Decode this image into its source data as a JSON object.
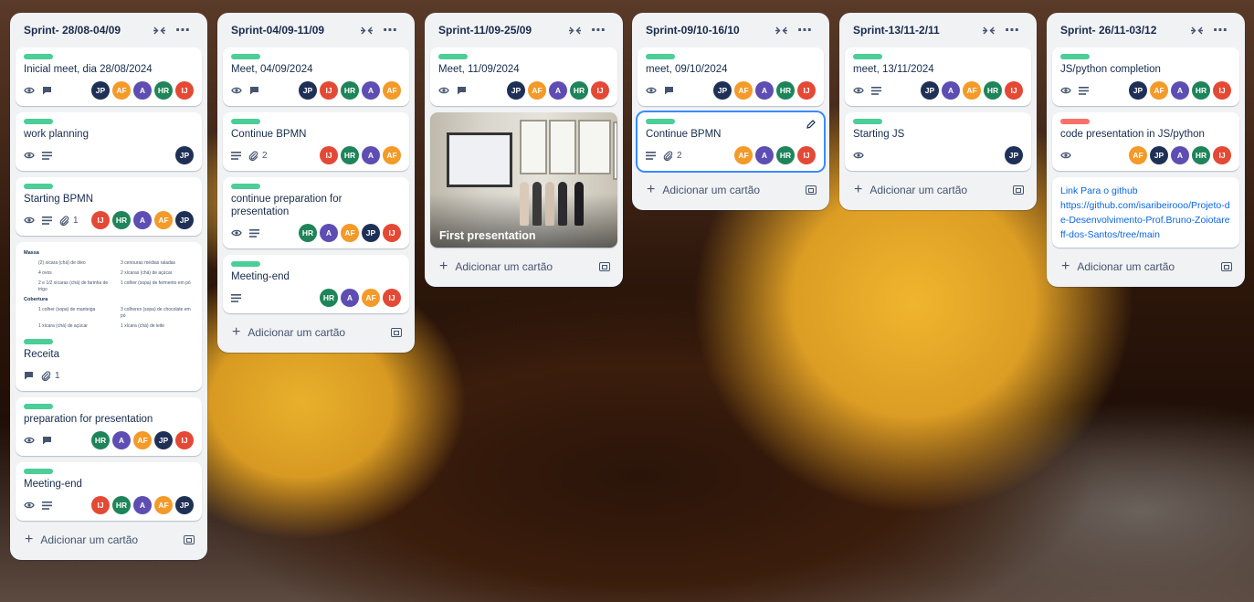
{
  "colors": {
    "JP": "#1f3056",
    "AF": "#f39a28",
    "A": "#5e4db2",
    "HR": "#1f845a",
    "IJ": "#e34935"
  },
  "add_card_label": "Adicionar um cartão",
  "lists": [
    {
      "title": "Sprint- 28/08-04/09",
      "cards": [
        {
          "title": "Inicial meet, dia 28/08/2024",
          "members": [
            "JP",
            "AF",
            "A",
            "HR",
            "IJ"
          ]
        },
        {
          "title": "work planning",
          "members": [
            "JP"
          ]
        },
        {
          "title": "Starting BPMN",
          "attachments": "1",
          "members": [
            "IJ",
            "HR",
            "A",
            "AF",
            "JP"
          ]
        },
        {
          "title": "Receita",
          "attachments": "1",
          "recipe": {
            "massa": "Massa",
            "m1a": "(2) xícara (chá) de óleo",
            "m1b": "3 cenouras médias raladas",
            "m2a": "4 ovos",
            "m2b": "2 xícaras (chá) de açúcar",
            "m3a": "2 e 1/2 xícaras (chá) de farinha de trigo",
            "m3b": "1 colher (sopa) de fermento em pó",
            "cobertura": "Cobertura",
            "c1a": "1 colher (sopa) de manteiga",
            "c1b": "3 colheres (sopa) de chocolate em pó",
            "c2a": "1 xícara (chá) de açúcar",
            "c2b": "1 xícara (chá) de leite"
          }
        },
        {
          "title": "preparation for presentation",
          "members": [
            "HR",
            "A",
            "AF",
            "JP",
            "IJ"
          ]
        },
        {
          "title": "Meeting-end",
          "members": [
            "IJ",
            "HR",
            "A",
            "AF",
            "JP"
          ]
        }
      ]
    },
    {
      "title": "Sprint-04/09-11/09",
      "cards": [
        {
          "title": "Meet, 04/09/2024",
          "members": [
            "JP",
            "IJ",
            "HR",
            "A",
            "AF"
          ]
        },
        {
          "title": "Continue BPMN",
          "attachments": "2",
          "members": [
            "IJ",
            "HR",
            "A",
            "AF"
          ]
        },
        {
          "title": "continue preparation for presentation",
          "members": [
            "HR",
            "A",
            "AF",
            "JP",
            "IJ"
          ]
        },
        {
          "title": "Meeting-end",
          "members": [
            "HR",
            "A",
            "AF",
            "IJ"
          ]
        }
      ]
    },
    {
      "title": "Sprint-11/09-25/09",
      "cards": [
        {
          "title": "Meet, 11/09/2024",
          "members": [
            "JP",
            "AF",
            "A",
            "HR",
            "IJ"
          ]
        },
        {
          "title": "First presentation"
        }
      ]
    },
    {
      "title": "Sprint-09/10-16/10",
      "cards": [
        {
          "title": "meet, 09/10/2024",
          "members": [
            "JP",
            "AF",
            "A",
            "HR",
            "IJ"
          ]
        },
        {
          "title": "Continue BPMN",
          "attachments": "2",
          "members": [
            "AF",
            "A",
            "HR",
            "IJ"
          ]
        }
      ]
    },
    {
      "title": "Sprint-13/11-2/11",
      "cards": [
        {
          "title": "meet, 13/11/2024",
          "members": [
            "JP",
            "A",
            "AF",
            "HR",
            "IJ"
          ]
        },
        {
          "title": "Starting JS",
          "members": [
            "JP"
          ]
        }
      ]
    },
    {
      "title": "Sprint- 26/11-03/12",
      "cards": [
        {
          "title": "JS/python completion",
          "members": [
            "JP",
            "AF",
            "A",
            "HR",
            "IJ"
          ]
        },
        {
          "title": "code presentation in JS/python",
          "members": [
            "AF",
            "JP",
            "A",
            "HR",
            "IJ"
          ]
        },
        {
          "link_line1": "Link Para o github",
          "link_line2": "https://github.com/isaribeirooo/Projeto-de-Desenvolvimento-Prof.Bruno-Zoiotareff-dos-Santos/tree/main"
        }
      ]
    }
  ]
}
